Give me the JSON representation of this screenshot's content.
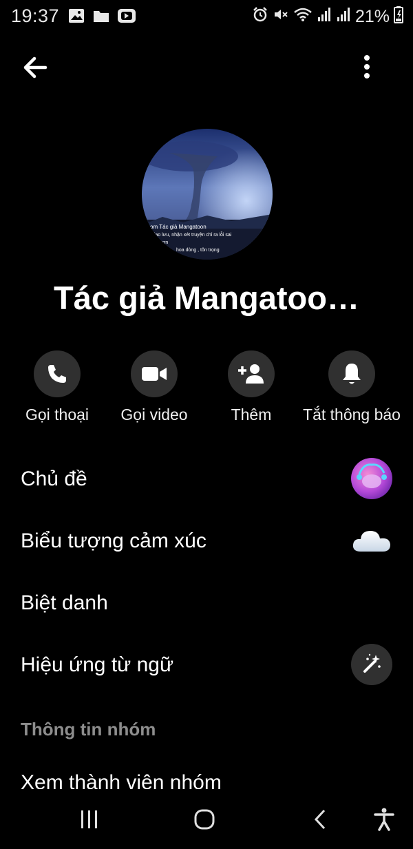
{
  "status_bar": {
    "time": "19:37",
    "battery": "21%",
    "icons_left": [
      "image-icon",
      "folder-icon",
      "youtube-icon"
    ],
    "icons_right": [
      "alarm-icon",
      "mute-icon",
      "wifi-icon",
      "signal-icon",
      "signal-icon",
      "battery-icon"
    ]
  },
  "header": {
    "back_icon": "arrow-left-icon",
    "more_icon": "more-vertical-icon"
  },
  "profile": {
    "name": "Tác giả Mangatoo…",
    "avatar_caption_lines": [
      "om Tác giả Mangatoon",
      "giao lưu, nhận xét truyện chỉ ra lỗi sai",
      "t hơn",
      "hoa dòng , tôn trọng"
    ]
  },
  "actions": [
    {
      "icon": "phone-icon",
      "label": "Gọi thoại"
    },
    {
      "icon": "video-camera-icon",
      "label": "Gọi video"
    },
    {
      "icon": "add-person-icon",
      "label": "Thêm"
    },
    {
      "icon": "bell-icon",
      "label": "Tắt thông báo"
    }
  ],
  "settings": [
    {
      "label": "Chủ đề",
      "right": "theme-thumbnail"
    },
    {
      "label": "Biểu tượng cảm xúc",
      "right": "cloud-emoji-icon"
    },
    {
      "label": "Biệt danh",
      "right": ""
    },
    {
      "label": "Hiệu ứng từ ngữ",
      "right": "magic-wand-icon"
    }
  ],
  "group_section": {
    "header": "Thông tin nhóm",
    "first_item": "Xem thành viên nhóm"
  },
  "colors": {
    "background": "#000000",
    "circle_bg": "#303030",
    "secondary_text": "#8d8d8d"
  }
}
